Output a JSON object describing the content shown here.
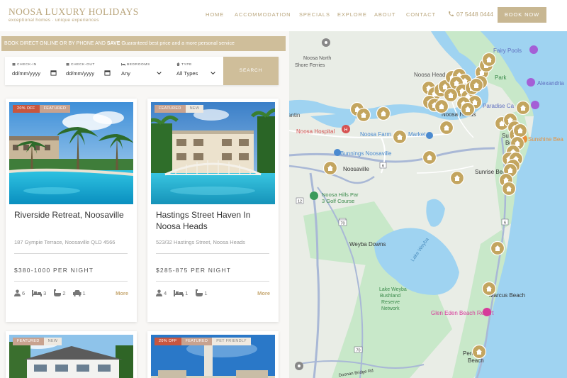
{
  "header": {
    "logo_title": "NOOSA LUXURY HOLIDAYS",
    "logo_subtitle": "exceptional homes · unique experiences",
    "nav": [
      "HOME",
      "ACCOMMODATION",
      "SPECIALS",
      "EXPLORE",
      "ABOUT",
      "CONTACT"
    ],
    "phone": "07 5448 0444",
    "book_now": "BOOK NOW"
  },
  "promo": {
    "lead": "BOOK DIRECT ONLINE OR BY PHONE AND",
    "bold": "SAVE",
    "rest": "Guaranteed best price and a more personal service"
  },
  "search": {
    "checkin_label": "CHECK-IN",
    "checkin_value": "dd/mm/yyyy",
    "checkout_label": "CHECK-OUT",
    "checkout_value": "dd/mm/yyyy",
    "bedrooms_label": "BEDROOMS",
    "bedrooms_value": "Any",
    "type_label": "TYPE",
    "type_value": "All Types",
    "button": "SEARCH"
  },
  "listings": [
    {
      "badges": [
        "20% OFF",
        "FEATURED"
      ],
      "title": "Riverside Retreat, Noosaville",
      "address": "187 Gympie Terrace, Noosaville QLD 4566",
      "price": "$380-1000  PER NIGHT",
      "guests": "6",
      "bedrooms": "3",
      "bathrooms": "2",
      "cars": "1",
      "more": "More"
    },
    {
      "badges": [
        "FEATURED",
        "NEW"
      ],
      "title": "Hastings Street Haven In Noosa Heads",
      "address": "523/32 Hastings Street, Noosa Heads",
      "price": "$285-875  PER NIGHT",
      "guests": "4",
      "bedrooms": "1",
      "bathrooms": "1",
      "more": "More"
    },
    {
      "badges": [
        "FEATURED",
        "NEW"
      ]
    },
    {
      "badges": [
        "20% OFF",
        "FEATURED",
        "PET FRIENDLY"
      ]
    }
  ],
  "map": {
    "labels": {
      "noosa_north": "Noosa North",
      "shore_ferries": "Shore Ferries",
      "fairy_pools": "Fairy Pools",
      "noosa_head": "Noosa Head",
      "park": "Park",
      "alexandria": "Alexandria",
      "paradise_cave": "Paradise Ca",
      "tantin": "antin",
      "noosa_heads": "Noosa Heads",
      "noosa_hospital": "Noosa Hospital",
      "noosa_farmers": "Noosa Farm",
      "market": "Market",
      "sunshine_beach": "Sunshine",
      "beach": "Beach",
      "sunshine_bea": "Sunshine Bea",
      "bunnings": "Bunnings Noosaville",
      "noosaville": "Noosaville",
      "sunrise_beach": "Sunrise Beach",
      "noosa_hills_1": "Noosa Hills Par",
      "noosa_hills_2": "3 Golf Course",
      "weyba_downs": "Weyba Downs",
      "lake_weyba": "Lake Weyba",
      "bushland_1": "Lake Weyba",
      "bushland_2": "Bushland",
      "bushland_3": "Reserve",
      "bushland_4": "Network",
      "marcus_beach": "Marcus Beach",
      "glen_eden": "Glen Eden Beach Resort",
      "peregian_1": "Pere",
      "peregian_2": "Beach",
      "doonan": "Doonan Bridge Rd",
      "road_70a": "70",
      "road_70b": "70",
      "road_6a": "6",
      "road_6b": "6",
      "road_12": "12",
      "road_6c": "6"
    }
  }
}
